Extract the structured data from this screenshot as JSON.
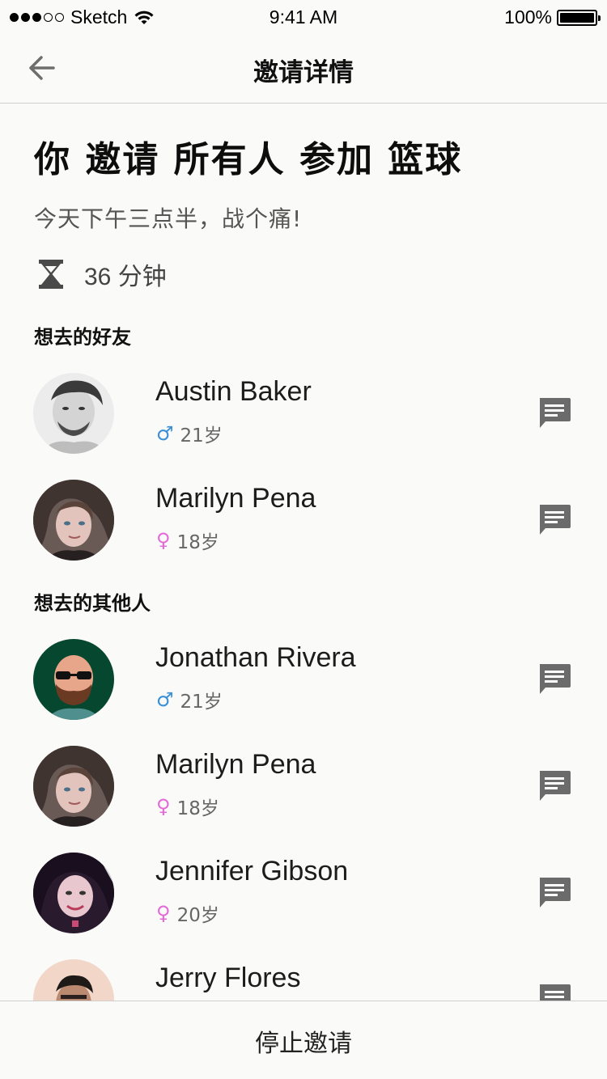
{
  "status_bar": {
    "carrier": "Sketch",
    "time": "9:41 AM",
    "battery": "100%",
    "battery_level": 1.0
  },
  "nav": {
    "title": "邀请详情",
    "back_icon": "arrow-left-icon"
  },
  "invite": {
    "headline": "你 邀请 所有人 参加 篮球",
    "description": "今天下午三点半，战个痛!",
    "duration": "36 分钟",
    "duration_icon": "hourglass-icon"
  },
  "sections": [
    {
      "title": "想去的好友",
      "people": [
        {
          "name": "Austin Baker",
          "gender": "male",
          "gender_symbol": "♂",
          "age": "21岁"
        },
        {
          "name": "Marilyn Pena",
          "gender": "female",
          "gender_symbol": "♀",
          "age": "18岁"
        }
      ]
    },
    {
      "title": "想去的其他人",
      "people": [
        {
          "name": "Jonathan Rivera",
          "gender": "male",
          "gender_symbol": "♂",
          "age": "21岁"
        },
        {
          "name": "Marilyn Pena",
          "gender": "female",
          "gender_symbol": "♀",
          "age": "18岁"
        },
        {
          "name": "Jennifer Gibson",
          "gender": "female",
          "gender_symbol": "♀",
          "age": "20岁"
        },
        {
          "name": "Jerry Flores",
          "gender": "male",
          "gender_symbol": "♂",
          "age": ""
        }
      ]
    }
  ],
  "bottom": {
    "stop_label": "停止邀请"
  },
  "colors": {
    "male": "#3a8fd6",
    "female": "#e46ad8",
    "message_icon": "#6b6b6b",
    "background": "#fafaf8"
  }
}
